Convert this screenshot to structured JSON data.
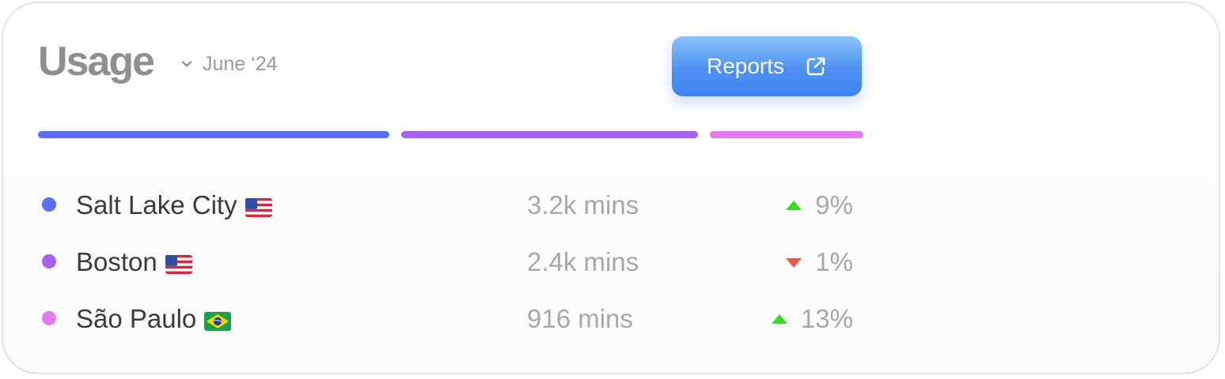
{
  "header": {
    "title": "Usage",
    "period": "June ‘24",
    "reports_label": "Reports"
  },
  "segments": [
    {
      "color": "#5b6ef5",
      "share": 0.425
    },
    {
      "color": "#a760f0",
      "share": 0.359
    },
    {
      "color": "#e07ded",
      "share": 0.186
    }
  ],
  "rows": [
    {
      "city": "Salt Lake City",
      "flag": "us-flag-icon",
      "dot_color": "#5b6ef5",
      "mins": "3.2k mins",
      "trend": "up",
      "pct": "9%"
    },
    {
      "city": "Boston",
      "flag": "us-flag-icon",
      "dot_color": "#a760f0",
      "mins": "2.4k mins",
      "trend": "down",
      "pct": "1%"
    },
    {
      "city": "São Paulo",
      "flag": "brazil-flag-icon",
      "dot_color": "#e07ded",
      "mins": "916 mins",
      "trend": "up",
      "pct": "13%"
    }
  ],
  "colors": {
    "up": "#33dd1f",
    "down": "#f0554c",
    "button": "#4d91f4"
  }
}
